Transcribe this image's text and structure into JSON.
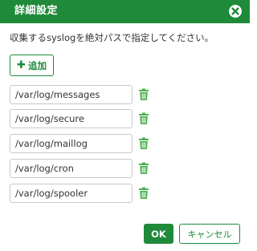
{
  "dialog": {
    "title": "詳細設定",
    "instruction": "収集するsyslogを絶対パスで指定してください。",
    "add_button_label": "追加",
    "paths": [
      "/var/log/messages",
      "/var/log/secure",
      "/var/log/maillog",
      "/var/log/cron",
      "/var/log/spooler"
    ],
    "ok_label": "OK",
    "cancel_label": "キャンセル"
  },
  "icons": {
    "close": "close-icon",
    "add": "plus-icon",
    "delete": "trash-icon"
  },
  "colors": {
    "accent": "#1f8a3a",
    "trash": "#4caf50",
    "input_border": "#c9c9c9",
    "text": "#333333"
  }
}
